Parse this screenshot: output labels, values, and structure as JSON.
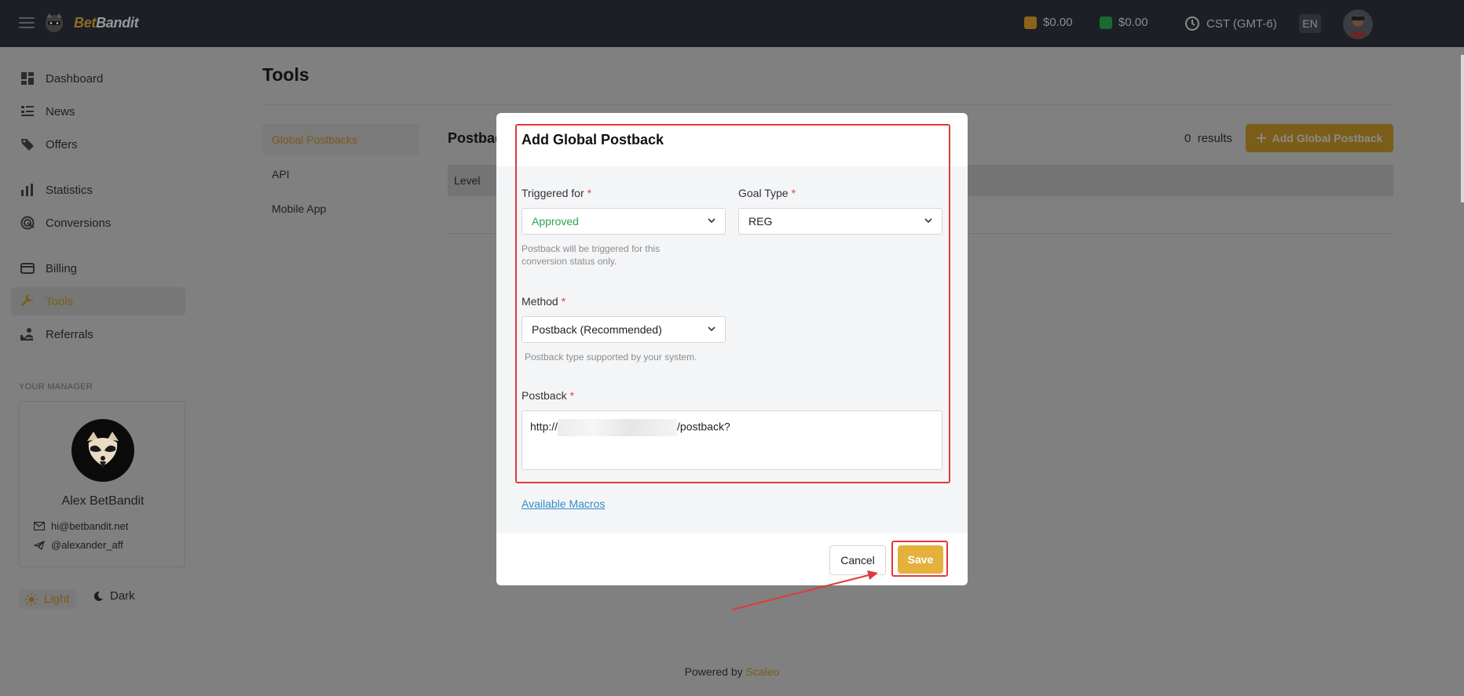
{
  "brand": {
    "name_part1": "Bet",
    "name_part2": "Bandit"
  },
  "topbar": {
    "balance_1": "$0.00",
    "balance_2": "$0.00",
    "timezone": "CST (GMT-6)",
    "language": "EN",
    "wallet_colors": {
      "balance_1": "#b07f1e",
      "balance_2": "#1f8a3d"
    }
  },
  "sidebar": {
    "items": [
      {
        "label": "Dashboard",
        "icon": "dashboard-icon"
      },
      {
        "label": "News",
        "icon": "news-icon"
      },
      {
        "label": "Offers",
        "icon": "tag-icon"
      },
      {
        "label": "Statistics",
        "icon": "bar-chart-icon"
      },
      {
        "label": "Conversions",
        "icon": "target-icon"
      },
      {
        "label": "Billing",
        "icon": "credit-card-icon"
      },
      {
        "label": "Tools",
        "icon": "wrench-icon",
        "active": true
      },
      {
        "label": "Referrals",
        "icon": "referrals-icon"
      }
    ],
    "manager_title": "YOUR MANAGER",
    "manager": {
      "name": "Alex BetBandit",
      "email": "hi@betbandit.net",
      "telegram": "@alexander_aff"
    },
    "theme": {
      "light": "Light",
      "dark": "Dark"
    }
  },
  "page": {
    "title": "Tools",
    "subnav": [
      "Global Postbacks",
      "API",
      "Mobile App"
    ],
    "section_title": "Postbac",
    "results_count": "0",
    "results_label": "results",
    "add_button": "Add Global Postback",
    "table_header": "Level"
  },
  "modal": {
    "title": "Add Global Postback",
    "triggered_for": {
      "label": "Triggered for",
      "value": "Approved",
      "hint": "Postback will be triggered for this conversion status only."
    },
    "goal_type": {
      "label": "Goal Type",
      "value": "REG"
    },
    "method": {
      "label": "Method",
      "value": "Postback (Recommended)",
      "hint": "Postback type supported by your system."
    },
    "postback": {
      "label": "Postback",
      "value_prefix": "http://",
      "value_suffix": "/postback?"
    },
    "macros_link": "Available Macros",
    "cancel": "Cancel",
    "save": "Save",
    "required_mark": "*"
  },
  "footer": {
    "powered_prefix": "Powered by",
    "powered_brand": "Scaleo"
  },
  "colors": {
    "accent": "#e3b13c",
    "highlight": "#e03a3a",
    "approved": "#2ea44f",
    "link": "#2f8dc9"
  }
}
